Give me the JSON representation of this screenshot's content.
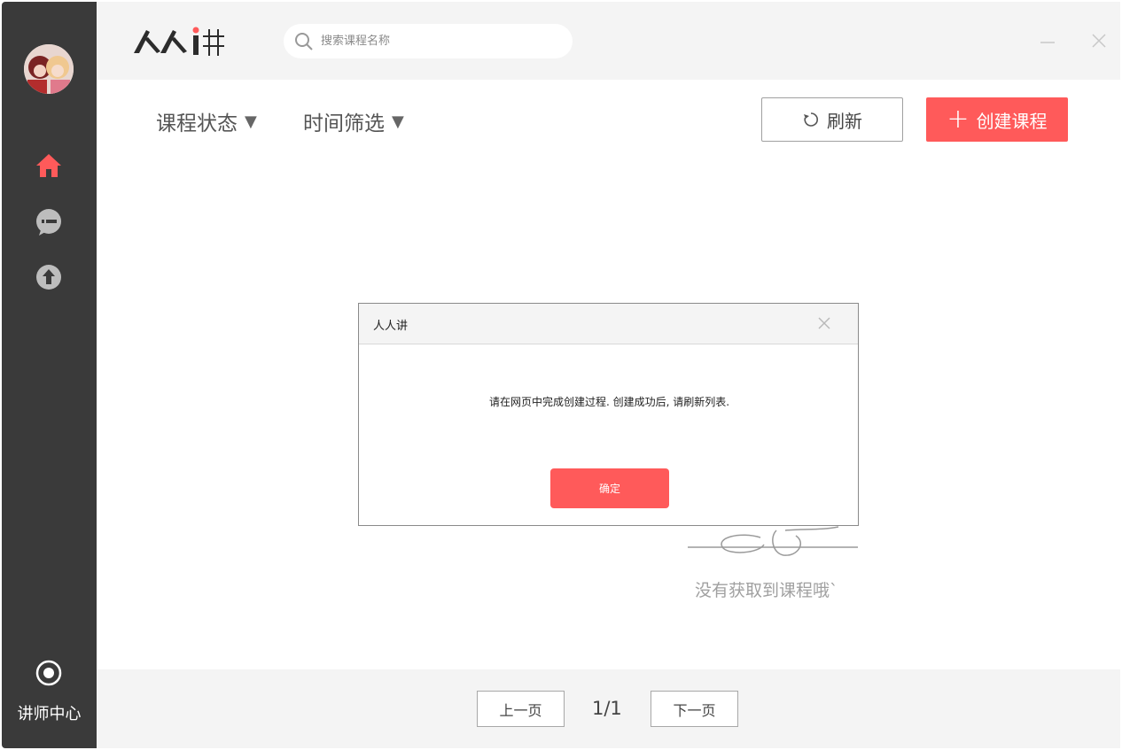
{
  "app": {
    "title": "人人讲"
  },
  "header": {
    "logo_text": "人人讲",
    "search_placeholder": "搜索课程名称"
  },
  "sidebar": {
    "items": [
      {
        "name": "home",
        "icon": "home-icon",
        "active": true
      },
      {
        "name": "messages",
        "icon": "chat-icon",
        "active": false
      },
      {
        "name": "upload",
        "icon": "upload-icon",
        "active": false
      }
    ],
    "teacher_center_label": "讲师中心"
  },
  "toolbar": {
    "course_status_label": "课程状态",
    "time_filter_label": "时间筛选",
    "refresh_label": "刷新",
    "create_label": "创建课程"
  },
  "empty_state": {
    "text": "没有获取到课程哦`"
  },
  "pagination": {
    "prev_label": "上一页",
    "page_indicator": "1/1",
    "next_label": "下一页"
  },
  "dialog": {
    "title": "人人讲",
    "message": "请在网页中完成创建过程. 创建成功后, 请刷新列表.",
    "ok_label": "确定"
  },
  "colors": {
    "accent": "#ff5a5a",
    "sidebar_bg": "#3a3a3a",
    "header_bg": "#f4f4f4"
  }
}
